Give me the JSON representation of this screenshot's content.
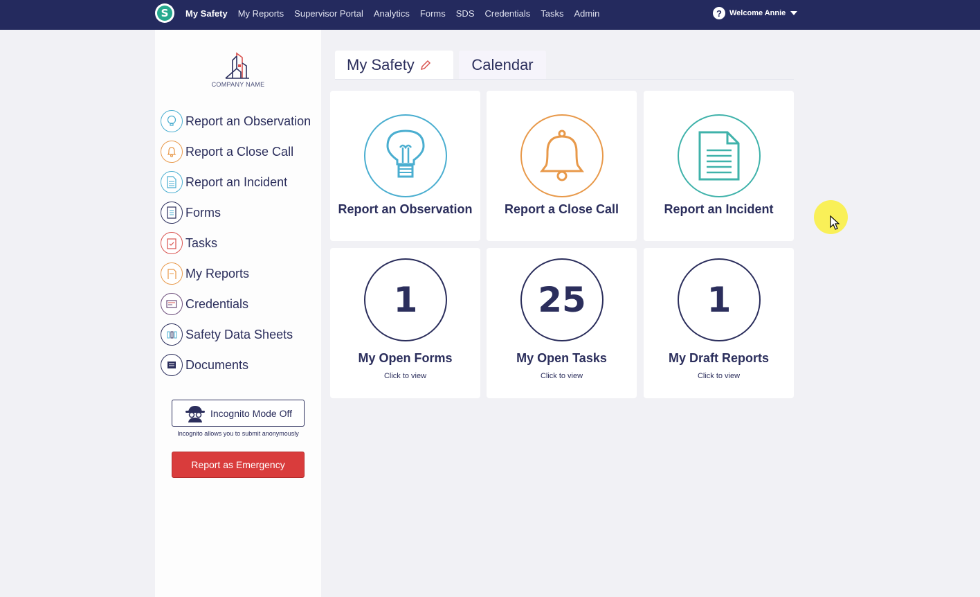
{
  "nav": {
    "logo_letter": "S",
    "links": [
      "My Safety",
      "My Reports",
      "Supervisor Portal",
      "Analytics",
      "Forms",
      "SDS",
      "Credentials",
      "Tasks",
      "Admin"
    ],
    "active": "My Safety",
    "help_glyph": "?",
    "user_greeting": "Welcome Annie"
  },
  "sidebar": {
    "company_name": "COMPANY NAME",
    "items": [
      {
        "label": "Report an Observation",
        "icon": "lightbulb-icon",
        "color": "#4aaed0"
      },
      {
        "label": "Report a Close Call",
        "icon": "bell-icon",
        "color": "#e8994a"
      },
      {
        "label": "Report an Incident",
        "icon": "document-icon",
        "color": "#4aaed0"
      },
      {
        "label": "Forms",
        "icon": "forms-icon",
        "color": "#2b2e5c"
      },
      {
        "label": "Tasks",
        "icon": "clipboard-check-icon",
        "color": "#d9534f"
      },
      {
        "label": "My Reports",
        "icon": "reports-icon",
        "color": "#e8994a"
      },
      {
        "label": "Credentials",
        "icon": "id-card-icon",
        "color": "#6b4c7a"
      },
      {
        "label": "Safety Data Sheets",
        "icon": "sds-icon",
        "color": "#2b2e5c"
      },
      {
        "label": "Documents",
        "icon": "documents-icon",
        "color": "#2b2e5c"
      }
    ],
    "incognito_label": "Incognito Mode Off",
    "incognito_note": "Incognito allows you to submit anonymously",
    "emergency_label": "Report as Emergency"
  },
  "tabs": [
    {
      "label": "My Safety",
      "active": true
    },
    {
      "label": "Calendar",
      "active": false
    }
  ],
  "cards": {
    "actions": [
      {
        "title": "Report an Observation",
        "icon": "lightbulb-icon",
        "color": "#4aaed0"
      },
      {
        "title": "Report a Close Call",
        "icon": "bell-icon",
        "color": "#e8994a"
      },
      {
        "title": "Report an Incident",
        "icon": "document-icon",
        "color": "#3fb2aa"
      }
    ],
    "counts": [
      {
        "count": "1",
        "title": "My Open Forms",
        "sub": "Click to view"
      },
      {
        "count": "25",
        "title": "My Open Tasks",
        "sub": "Click to view"
      },
      {
        "count": "1",
        "title": "My Draft Reports",
        "sub": "Click to view"
      }
    ]
  }
}
